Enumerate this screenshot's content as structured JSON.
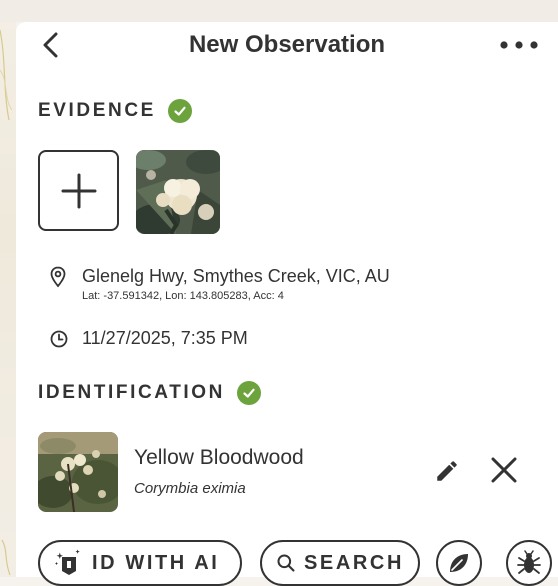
{
  "header": {
    "title": "New Observation"
  },
  "evidence": {
    "title": "EVIDENCE",
    "location": "Glenelg Hwy, Smythes Creek, VIC, AU",
    "coords": "Lat: -37.591342, Lon: 143.805283, Acc: 4",
    "datetime": "11/27/2025, 7:35 PM"
  },
  "identification": {
    "title": "IDENTIFICATION",
    "common_name": "Yellow Bloodwood",
    "scientific_name": "Corymbia eximia"
  },
  "actions": {
    "ai_label": "ID WITH AI",
    "search_label": "SEARCH"
  },
  "colors": {
    "check": "#6ca33d",
    "text": "#333333"
  }
}
